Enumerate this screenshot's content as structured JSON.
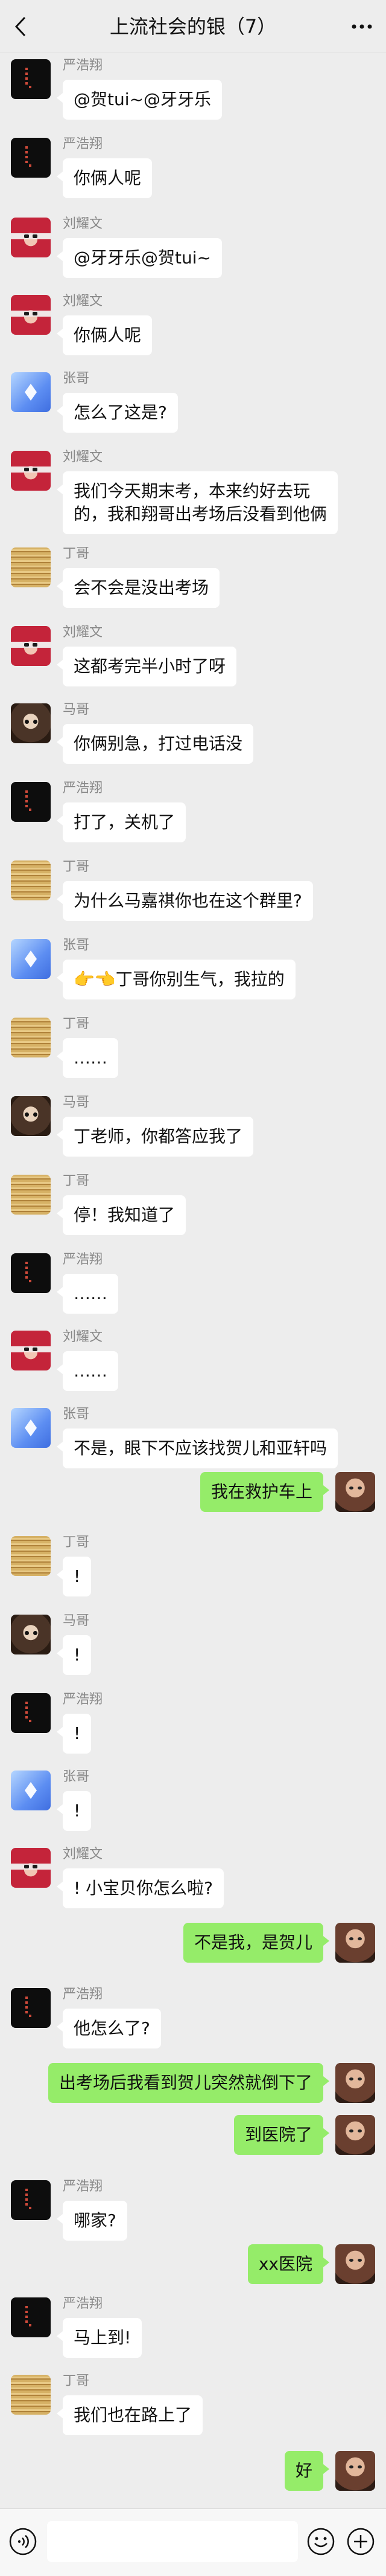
{
  "header": {
    "title": "上流社会的银（7）"
  },
  "messages": [
    {
      "side": "left",
      "sender": "严浩翔",
      "avatar": "av-yan",
      "lines": [
        "@贺tui~@牙牙乐"
      ]
    },
    {
      "side": "left",
      "sender": "严浩翔",
      "avatar": "av-yan",
      "lines": [
        "你俩人呢"
      ]
    },
    {
      "side": "left",
      "sender": "刘耀文",
      "avatar": "av-liu",
      "lines": [
        "@牙牙乐@贺tui~"
      ]
    },
    {
      "side": "left",
      "sender": "刘耀文",
      "avatar": "av-liu",
      "lines": [
        "你俩人呢"
      ]
    },
    {
      "side": "left",
      "sender": "张哥",
      "avatar": "av-zhang",
      "lines": [
        "怎么了这是?"
      ]
    },
    {
      "side": "left",
      "sender": "刘耀文",
      "avatar": "av-liu",
      "lines": [
        "我们今天期末考，本来约好去玩",
        "的，我和翔哥出考场后没看到他俩"
      ]
    },
    {
      "side": "left",
      "sender": "丁哥",
      "avatar": "av-ding",
      "lines": [
        "会不会是没出考场"
      ]
    },
    {
      "side": "left",
      "sender": "刘耀文",
      "avatar": "av-liu",
      "lines": [
        "这都考完半小时了呀"
      ]
    },
    {
      "side": "left",
      "sender": "马哥",
      "avatar": "av-ma",
      "lines": [
        "你俩别急，打过电话没"
      ]
    },
    {
      "side": "left",
      "sender": "严浩翔",
      "avatar": "av-yan",
      "lines": [
        "打了，关机了"
      ]
    },
    {
      "side": "left",
      "sender": "丁哥",
      "avatar": "av-ding",
      "lines": [
        "为什么马嘉祺你也在这个群里?"
      ]
    },
    {
      "side": "left",
      "sender": "张哥",
      "avatar": "av-zhang",
      "lines": [
        "👉👈丁哥你别生气，我拉的"
      ]
    },
    {
      "side": "left",
      "sender": "丁哥",
      "avatar": "av-ding",
      "lines": [
        "……"
      ]
    },
    {
      "side": "left",
      "sender": "马哥",
      "avatar": "av-ma",
      "lines": [
        "丁老师，你都答应我了"
      ]
    },
    {
      "side": "left",
      "sender": "丁哥",
      "avatar": "av-ding",
      "lines": [
        "停！我知道了"
      ]
    },
    {
      "side": "left",
      "sender": "严浩翔",
      "avatar": "av-yan",
      "lines": [
        "……"
      ]
    },
    {
      "side": "left",
      "sender": "刘耀文",
      "avatar": "av-liu",
      "lines": [
        "……"
      ]
    },
    {
      "side": "left",
      "sender": "张哥",
      "avatar": "av-zhang",
      "lines": [
        "不是，眼下不应该找贺儿和亚轩吗"
      ]
    },
    {
      "side": "right",
      "sender": "",
      "avatar": "av-me",
      "lines": [
        "我在救护车上"
      ]
    },
    {
      "side": "left",
      "sender": "丁哥",
      "avatar": "av-ding",
      "lines": [
        "!"
      ]
    },
    {
      "side": "left",
      "sender": "马哥",
      "avatar": "av-ma",
      "lines": [
        "!"
      ]
    },
    {
      "side": "left",
      "sender": "严浩翔",
      "avatar": "av-yan",
      "lines": [
        "!"
      ]
    },
    {
      "side": "left",
      "sender": "张哥",
      "avatar": "av-zhang",
      "lines": [
        "!"
      ]
    },
    {
      "side": "left",
      "sender": "刘耀文",
      "avatar": "av-liu",
      "lines": [
        "! 小宝贝你怎么啦?"
      ]
    },
    {
      "side": "right",
      "sender": "",
      "avatar": "av-me",
      "lines": [
        "不是我，是贺儿"
      ]
    },
    {
      "side": "left",
      "sender": "严浩翔",
      "avatar": "av-yan",
      "lines": [
        "他怎么了?"
      ]
    },
    {
      "side": "right",
      "sender": "",
      "avatar": "av-me",
      "lines": [
        "出考场后我看到贺儿突然就倒下了"
      ]
    },
    {
      "side": "right",
      "sender": "",
      "avatar": "av-me",
      "lines": [
        "到医院了"
      ]
    },
    {
      "side": "left",
      "sender": "严浩翔",
      "avatar": "av-yan",
      "lines": [
        "哪家?"
      ]
    },
    {
      "side": "right",
      "sender": "",
      "avatar": "av-me",
      "lines": [
        "xx医院"
      ]
    },
    {
      "side": "left",
      "sender": "严浩翔",
      "avatar": "av-yan",
      "lines": [
        "马上到!"
      ]
    },
    {
      "side": "left",
      "sender": "丁哥",
      "avatar": "av-ding",
      "lines": [
        "我们也在路上了"
      ]
    },
    {
      "side": "right",
      "sender": "",
      "avatar": "av-me",
      "lines": [
        "好"
      ]
    }
  ]
}
